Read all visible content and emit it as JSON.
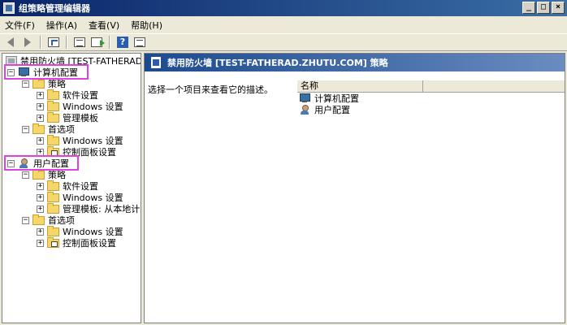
{
  "window": {
    "title": "组策略管理编辑器",
    "btn_min": "_",
    "btn_max": "□",
    "btn_close": "×"
  },
  "menu": [
    "文件(F)",
    "操作(A)",
    "查看(V)",
    "帮助(H)"
  ],
  "toolbar": {
    "help_label": "?"
  },
  "tree": {
    "root": "禁用防火墙 [TEST-FATHERAD.ZHUTU.COM] 策略",
    "computer_config": "计算机配置",
    "policies": "策略",
    "software_settings": "软件设置",
    "windows_settings": "Windows 设置",
    "admin_templates": "管理模板",
    "preferences": "首选项",
    "control_panel_settings": "控制面板设置",
    "user_config": "用户配置",
    "admin_templates_local": "管理模板: 从本地计算机检索的策略定义",
    "expanded": "−",
    "collapsed": "+"
  },
  "right_pane": {
    "header": "禁用防火墙 [TEST-FATHERAD.ZHUTU.COM] 策略",
    "description": "选择一个项目来查看它的描述。",
    "column_name": "名称",
    "items": [
      "计算机配置",
      "用户配置"
    ]
  },
  "colors": {
    "highlight": "#e040e0",
    "title_bar": "#0a246a",
    "pane_header": "#1c4a8e"
  }
}
